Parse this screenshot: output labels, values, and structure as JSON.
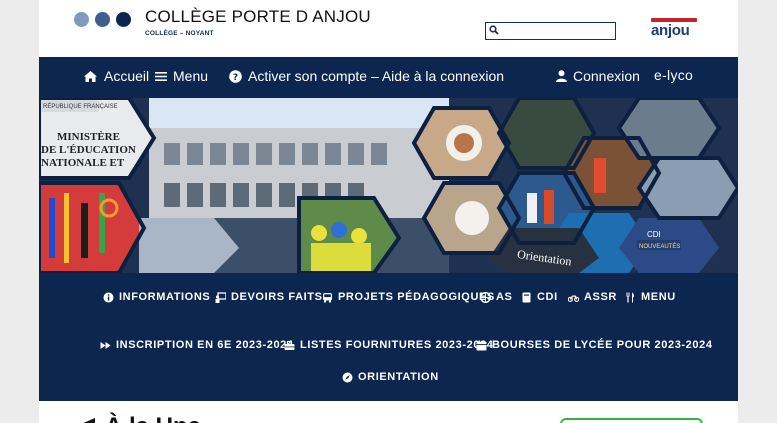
{
  "header": {
    "title": "COLLÈGE PORTE D ANJOU",
    "subtitle": "COLLÈGE – NOYANT",
    "dot_colors": [
      "#7f9bbd",
      "#3f5f8f",
      "#0c2650"
    ],
    "search_placeholder": "",
    "dept_logo_text": "anjou",
    "accent": "#0c2650"
  },
  "topnav": {
    "home": "Accueil",
    "menu": "Menu",
    "activate": "Activer son compte – Aide à la connexion",
    "login": "Connexion",
    "elyco": "e-lyco"
  },
  "banner": {
    "sign_text": [
      "MINISTÈRE",
      "DE L'ÉDUCATION",
      "NATIONALE ET"
    ],
    "flag_text": "RÉPUBLIQUE FRANÇAISE",
    "orientation_label": "Orientation",
    "cdi_label": "CDI",
    "nouveautes_label": "NOUVEAUTÉS"
  },
  "menu": {
    "row1": [
      "INFORMATIONS",
      "DEVOIRS FAITS",
      "PROJETS PÉDAGOGIQUES",
      "AS",
      "CDI",
      "ASSR",
      "MENU"
    ],
    "row2": [
      "INSCRIPTION EN 6E 2023-2024",
      "LISTES FOURNITURES 2023-2024",
      "BOURSES DE LYCÉE POUR 2023-2024"
    ],
    "row3": [
      "ORIENTATION"
    ]
  },
  "main": {
    "heading": "À la Une"
  }
}
